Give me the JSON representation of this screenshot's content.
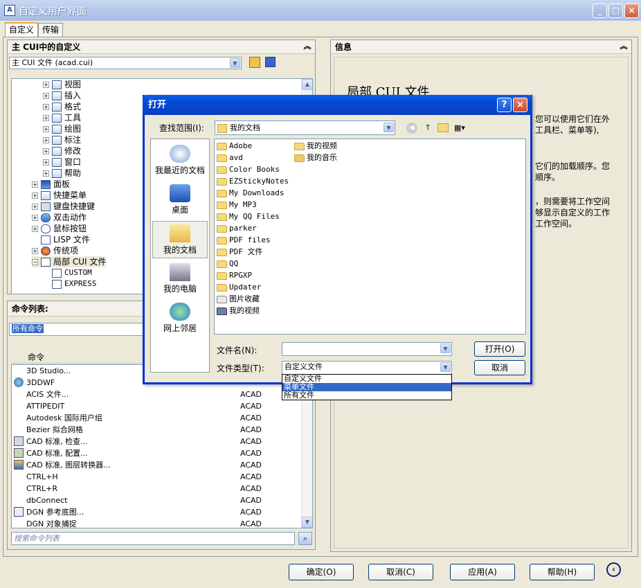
{
  "window": {
    "title": "自定义用户界面"
  },
  "tabs": [
    {
      "label": "自定义"
    },
    {
      "label": "传输"
    }
  ],
  "left_panel": {
    "header": "主 CUI中的自定义",
    "file_combo": "主 CUI 文件 (acad.cui)",
    "tree": [
      {
        "label": "视图"
      },
      {
        "label": "插入"
      },
      {
        "label": "格式"
      },
      {
        "label": "工具"
      },
      {
        "label": "绘图"
      },
      {
        "label": "标注"
      },
      {
        "label": "修改"
      },
      {
        "label": "窗口"
      },
      {
        "label": "帮助"
      },
      {
        "label": "面板"
      },
      {
        "label": "快捷菜单"
      },
      {
        "label": "键盘快捷键"
      },
      {
        "label": "双击动作"
      },
      {
        "label": "鼠标按钮"
      },
      {
        "label": "LISP 文件"
      },
      {
        "label": "传统项"
      },
      {
        "label": "局部 CUI 文件"
      },
      {
        "label": "CUSTOM"
      },
      {
        "label": "EXPRESS"
      }
    ]
  },
  "command_panel": {
    "header": "命令列表:",
    "filter_value": "所有命令",
    "column_command": "命令",
    "rows": [
      {
        "name": "3D Studio...",
        "source": ""
      },
      {
        "name": "3DDWF",
        "source": ""
      },
      {
        "name": "ACIS 文件...",
        "source": "ACAD"
      },
      {
        "name": "ATTIPEDIT",
        "source": "ACAD"
      },
      {
        "name": "Autodesk 国际用户组",
        "source": "ACAD"
      },
      {
        "name": "Bezier 拟合网格",
        "source": "ACAD"
      },
      {
        "name": "CAD 标准, 检查...",
        "source": "ACAD"
      },
      {
        "name": "CAD 标准, 配置...",
        "source": "ACAD"
      },
      {
        "name": "CAD 标准, 图层转换器...",
        "source": "ACAD"
      },
      {
        "name": "CTRL+H",
        "source": "ACAD"
      },
      {
        "name": "CTRL+R",
        "source": "ACAD"
      },
      {
        "name": "dbConnect",
        "source": "ACAD"
      },
      {
        "name": "DGN 参考底图...",
        "source": "ACAD"
      },
      {
        "name": "DGN 对象捕捉",
        "source": "ACAD"
      }
    ],
    "search_placeholder": "搜索命令列表"
  },
  "info_panel": {
    "header": "信息",
    "title": "局部 CUI 文件",
    "lines": [
      "您可以使用它们在外",
      "工具栏、菜单等),",
      "它们的加载顺序。您",
      "顺序。",
      "，则需要将工作空间",
      "够显示自定义的工作",
      "工作空间。"
    ]
  },
  "bottom_buttons": {
    "ok": "确定(O)",
    "cancel": "取消(C)",
    "apply": "应用(A)",
    "help": "帮助(H)"
  },
  "dialog": {
    "title": "打开",
    "look_in_label": "查找范围(I):",
    "look_in_value": "我的文档",
    "places": [
      {
        "label": "我最近的文档"
      },
      {
        "label": "桌面"
      },
      {
        "label": "我的文档"
      },
      {
        "label": "我的电脑"
      },
      {
        "label": "网上邻居"
      }
    ],
    "files_col1": [
      "Adobe",
      "avd",
      "Color Books",
      "EZStickyNotes",
      "My Downloads",
      "My MP3",
      "My QQ Files",
      "parker",
      "PDF files",
      "PDF 文件",
      "QQ",
      "RPGXP",
      "Updater",
      "图片收藏",
      "我的视频"
    ],
    "files_col2": [
      "我的视频",
      "我的音乐"
    ],
    "filename_label": "文件名(N):",
    "filename_value": "",
    "filetype_label": "文件类型(T):",
    "filetype_value": "自定义文件",
    "filetype_options": [
      "自定义文件",
      "菜单文件",
      "所有文件"
    ],
    "open_button": "打开(O)",
    "cancel_button": "取消"
  }
}
